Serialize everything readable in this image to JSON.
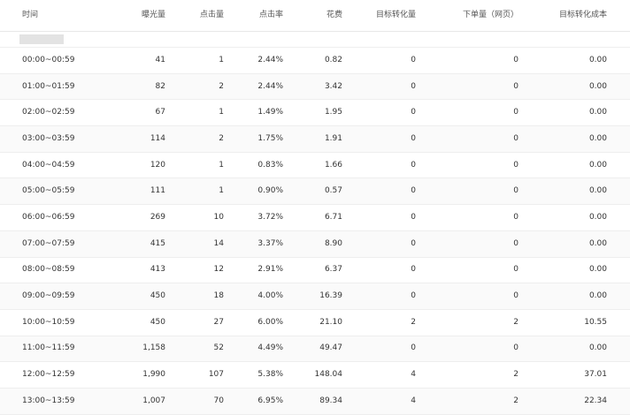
{
  "table": {
    "headers": {
      "time": "时间",
      "impressions": "曝光量",
      "clicks": "点击量",
      "ctr": "点击率",
      "cost": "花费",
      "conversions": "目标转化量",
      "orders": "下单量（网页）",
      "cpa": "目标转化成本"
    },
    "rows": [
      [
        "00:00~00:59",
        "41",
        "1",
        "2.44%",
        "0.82",
        "0",
        "0",
        "0.00"
      ],
      [
        "01:00~01:59",
        "82",
        "2",
        "2.44%",
        "3.42",
        "0",
        "0",
        "0.00"
      ],
      [
        "02:00~02:59",
        "67",
        "1",
        "1.49%",
        "1.95",
        "0",
        "0",
        "0.00"
      ],
      [
        "03:00~03:59",
        "114",
        "2",
        "1.75%",
        "1.91",
        "0",
        "0",
        "0.00"
      ],
      [
        "04:00~04:59",
        "120",
        "1",
        "0.83%",
        "1.66",
        "0",
        "0",
        "0.00"
      ],
      [
        "05:00~05:59",
        "111",
        "1",
        "0.90%",
        "0.57",
        "0",
        "0",
        "0.00"
      ],
      [
        "06:00~06:59",
        "269",
        "10",
        "3.72%",
        "6.71",
        "0",
        "0",
        "0.00"
      ],
      [
        "07:00~07:59",
        "415",
        "14",
        "3.37%",
        "8.90",
        "0",
        "0",
        "0.00"
      ],
      [
        "08:00~08:59",
        "413",
        "12",
        "2.91%",
        "6.37",
        "0",
        "0",
        "0.00"
      ],
      [
        "09:00~09:59",
        "450",
        "18",
        "4.00%",
        "16.39",
        "0",
        "0",
        "0.00"
      ],
      [
        "10:00~10:59",
        "450",
        "27",
        "6.00%",
        "21.10",
        "2",
        "2",
        "10.55"
      ],
      [
        "11:00~11:59",
        "1,158",
        "52",
        "4.49%",
        "49.47",
        "0",
        "0",
        "0.00"
      ],
      [
        "12:00~12:59",
        "1,990",
        "107",
        "5.38%",
        "148.04",
        "4",
        "2",
        "37.01"
      ],
      [
        "13:00~13:59",
        "1,007",
        "70",
        "6.95%",
        "89.34",
        "4",
        "2",
        "22.34"
      ]
    ]
  }
}
